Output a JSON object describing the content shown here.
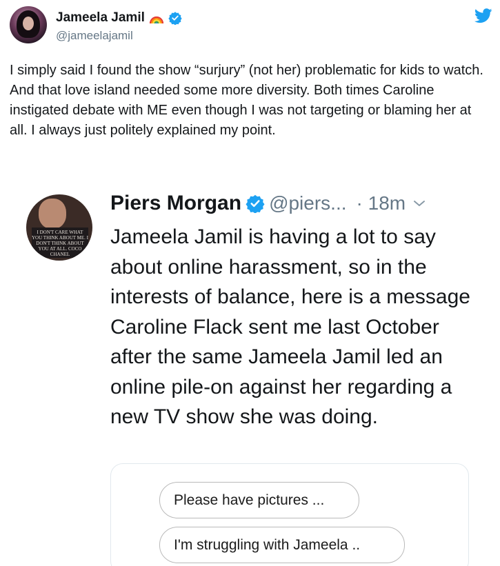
{
  "tweet": {
    "author_name": "Jameela Jamil",
    "author_handle": "@jameelajamil",
    "emoji_icon": "rainbow-emoji",
    "verified_icon": "verified-badge-icon",
    "platform_icon": "twitter-bird-icon",
    "text": "I simply said I found the show “surjury” (not her) problematic for kids to watch. And that love island needed some more diversity. Both times Caroline instigated debate with ME even though I was not targeting or blaming her at all. I always just politely explained my point."
  },
  "quoted_tweet": {
    "author_name": "Piers Morgan",
    "author_handle": "@piers...",
    "time": "· 18m",
    "avatar_sign_text": "I DON'T CARE WHAT YOU THINK ABOUT ME. I DON'T THINK ABOUT YOU AT ALL. COCO CHANEL",
    "text": "Jameela Jamil is having a lot to say about online harassment, so in the interests of balance, here is a message Caroline Flack sent me last October after the same Jameela Jamil led an online pile-on against her regarding a new TV show she was doing.",
    "message_bubbles": [
      {
        "text": "Please have pictures ..."
      },
      {
        "text": "I'm struggling with Jameela .."
      }
    ]
  },
  "colors": {
    "text": "#14171a",
    "secondary": "#657786",
    "twitter_blue": "#1da1f2",
    "border": "#e1e8ed"
  }
}
